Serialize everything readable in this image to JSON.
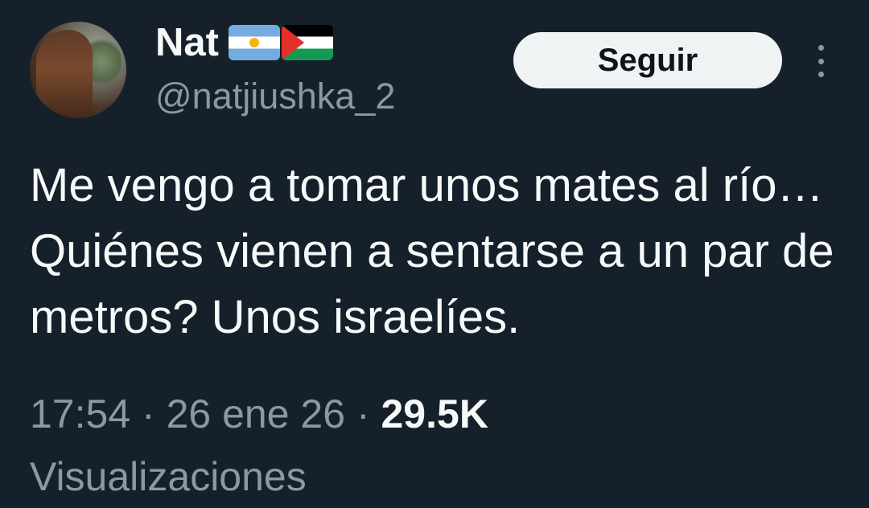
{
  "author": {
    "display_name": "Nat",
    "handle": "@natjiushka_2",
    "flags": [
      "argentina-flag",
      "palestine-flag"
    ]
  },
  "actions": {
    "follow_label": "Seguir",
    "more_icon": "more-vertical-icon"
  },
  "tweet": {
    "text": "Me vengo a tomar unos mates al río… Quiénes vienen a sentarse a un par de metros? Unos israelíes."
  },
  "meta": {
    "time": "17:54",
    "separator": "·",
    "date": "26 ene 26",
    "views_count": "29.5K",
    "views_label": "Visualizaciones"
  },
  "colors": {
    "background": "#15202b",
    "primary_text": "#f7f9f9",
    "secondary_text": "#8b98a5",
    "follow_button_bg": "#eff3f4",
    "follow_button_text": "#0f1419"
  }
}
